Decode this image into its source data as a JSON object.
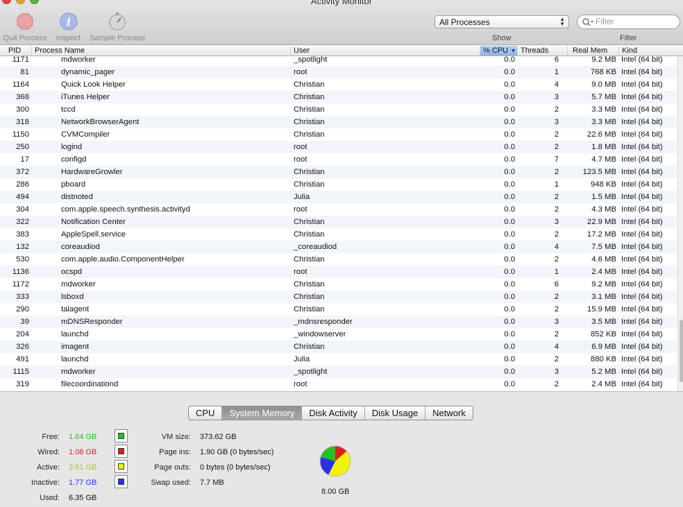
{
  "window": {
    "title": "Activity Monitor"
  },
  "toolbar": {
    "quit_label": "Quit Process",
    "inspect_label": "Inspect",
    "sample_label": "Sample Process",
    "show_label": "Show",
    "filter_label": "Filter",
    "process_filter": "All Processes",
    "search_placeholder": "Filter"
  },
  "table": {
    "columns": {
      "pid": "PID",
      "name": "Process Name",
      "user": "User",
      "cpu": "% CPU",
      "threads": "Threads",
      "mem": "Real Mem",
      "kind": "Kind"
    },
    "rows": [
      {
        "pid": "1171",
        "name": "mdworker",
        "user": "_spotlight",
        "cpu": "0.0",
        "threads": "6",
        "mem": "9.2 MB",
        "kind": "Intel (64 bit)"
      },
      {
        "pid": "81",
        "name": "dynamic_pager",
        "user": "root",
        "cpu": "0.0",
        "threads": "1",
        "mem": "768 KB",
        "kind": "Intel (64 bit)"
      },
      {
        "pid": "1164",
        "name": "Quick Look Helper",
        "user": "Christian",
        "cpu": "0.0",
        "threads": "4",
        "mem": "9.0 MB",
        "kind": "Intel (64 bit)"
      },
      {
        "pid": "368",
        "name": "iTunes Helper",
        "user": "Christian",
        "cpu": "0.0",
        "threads": "3",
        "mem": "5.7 MB",
        "kind": "Intel (64 bit)"
      },
      {
        "pid": "300",
        "name": "tccd",
        "user": "Christian",
        "cpu": "0.0",
        "threads": "2",
        "mem": "3.3 MB",
        "kind": "Intel (64 bit)"
      },
      {
        "pid": "318",
        "name": "NetworkBrowserAgent",
        "user": "Christian",
        "cpu": "0.0",
        "threads": "3",
        "mem": "3.3 MB",
        "kind": "Intel (64 bit)"
      },
      {
        "pid": "1150",
        "name": "CVMCompiler",
        "user": "Christian",
        "cpu": "0.0",
        "threads": "2",
        "mem": "22.6 MB",
        "kind": "Intel (64 bit)"
      },
      {
        "pid": "250",
        "name": "logind",
        "user": "root",
        "cpu": "0.0",
        "threads": "2",
        "mem": "1.8 MB",
        "kind": "Intel (64 bit)"
      },
      {
        "pid": "17",
        "name": "configd",
        "user": "root",
        "cpu": "0.0",
        "threads": "7",
        "mem": "4.7 MB",
        "kind": "Intel (64 bit)"
      },
      {
        "pid": "372",
        "name": "HardwareGrowler",
        "user": "Christian",
        "cpu": "0.0",
        "threads": "2",
        "mem": "123.5 MB",
        "kind": "Intel (64 bit)"
      },
      {
        "pid": "286",
        "name": "pboard",
        "user": "Christian",
        "cpu": "0.0",
        "threads": "1",
        "mem": "948 KB",
        "kind": "Intel (64 bit)"
      },
      {
        "pid": "494",
        "name": "distnoted",
        "user": "Julia",
        "cpu": "0.0",
        "threads": "2",
        "mem": "1.5 MB",
        "kind": "Intel (64 bit)"
      },
      {
        "pid": "304",
        "name": "com.apple.speech.synthesis.activityd",
        "user": "root",
        "cpu": "0.0",
        "threads": "2",
        "mem": "4.3 MB",
        "kind": "Intel (64 bit)"
      },
      {
        "pid": "322",
        "name": "Notification Center",
        "user": "Christian",
        "cpu": "0.0",
        "threads": "3",
        "mem": "22.9 MB",
        "kind": "Intel (64 bit)"
      },
      {
        "pid": "383",
        "name": "AppleSpell.service",
        "user": "Christian",
        "cpu": "0.0",
        "threads": "2",
        "mem": "17.2 MB",
        "kind": "Intel (64 bit)"
      },
      {
        "pid": "132",
        "name": "coreaudiod",
        "user": "_coreaudiod",
        "cpu": "0.0",
        "threads": "4",
        "mem": "7.5 MB",
        "kind": "Intel (64 bit)"
      },
      {
        "pid": "530",
        "name": "com.apple.audio.ComponentHelper",
        "user": "Christian",
        "cpu": "0.0",
        "threads": "2",
        "mem": "4.6 MB",
        "kind": "Intel (64 bit)"
      },
      {
        "pid": "1136",
        "name": "ocspd",
        "user": "root",
        "cpu": "0.0",
        "threads": "1",
        "mem": "2.4 MB",
        "kind": "Intel (64 bit)"
      },
      {
        "pid": "1172",
        "name": "mdworker",
        "user": "Christian",
        "cpu": "0.0",
        "threads": "6",
        "mem": "9.2 MB",
        "kind": "Intel (64 bit)"
      },
      {
        "pid": "333",
        "name": "lsboxd",
        "user": "Christian",
        "cpu": "0.0",
        "threads": "2",
        "mem": "3.1 MB",
        "kind": "Intel (64 bit)"
      },
      {
        "pid": "290",
        "name": "talagent",
        "user": "Christian",
        "cpu": "0.0",
        "threads": "2",
        "mem": "15.9 MB",
        "kind": "Intel (64 bit)"
      },
      {
        "pid": "39",
        "name": "mDNSResponder",
        "user": "_mdnsresponder",
        "cpu": "0.0",
        "threads": "3",
        "mem": "3.5 MB",
        "kind": "Intel (64 bit)"
      },
      {
        "pid": "204",
        "name": "launchd",
        "user": "_windowserver",
        "cpu": "0.0",
        "threads": "2",
        "mem": "852 KB",
        "kind": "Intel (64 bit)"
      },
      {
        "pid": "326",
        "name": "imagent",
        "user": "Christian",
        "cpu": "0.0",
        "threads": "4",
        "mem": "6.9 MB",
        "kind": "Intel (64 bit)"
      },
      {
        "pid": "491",
        "name": "launchd",
        "user": "Julia",
        "cpu": "0.0",
        "threads": "2",
        "mem": "880 KB",
        "kind": "Intel (64 bit)"
      },
      {
        "pid": "1115",
        "name": "mdworker",
        "user": "_spotlight",
        "cpu": "0.0",
        "threads": "3",
        "mem": "5.2 MB",
        "kind": "Intel (64 bit)"
      },
      {
        "pid": "319",
        "name": "filecoordinationd",
        "user": "root",
        "cpu": "0.0",
        "threads": "2",
        "mem": "2.4 MB",
        "kind": "Intel (64 bit)"
      }
    ]
  },
  "tabs": [
    "CPU",
    "System Memory",
    "Disk Activity",
    "Disk Usage",
    "Network"
  ],
  "active_tab": "System Memory",
  "memory": {
    "free_label": "Free:",
    "free_value": "1.64 GB",
    "free_color": "#22c322",
    "wired_label": "Wired:",
    "wired_value": "1.08 GB",
    "wired_color": "#e02020",
    "active_label": "Active:",
    "active_value": "3.51 GB",
    "active_color": "#f2f20e",
    "inactive_label": "Inactive:",
    "inactive_value": "1.77 GB",
    "inactive_color": "#2f2fe6",
    "used_label": "Used:",
    "used_value": "6.35 GB",
    "vm_size_label": "VM size:",
    "vm_size_value": "373.62 GB",
    "page_ins_label": "Page ins:",
    "page_ins_value": "1.90 GB (0 bytes/sec)",
    "page_outs_label": "Page outs:",
    "page_outs_value": "0 bytes (0 bytes/sec)",
    "swap_used_label": "Swap used:",
    "swap_used_value": "7.7 MB",
    "total": "8.00 GB",
    "pie_gb": {
      "free": 1.64,
      "wired": 1.08,
      "active": 3.51,
      "inactive": 1.77
    }
  }
}
